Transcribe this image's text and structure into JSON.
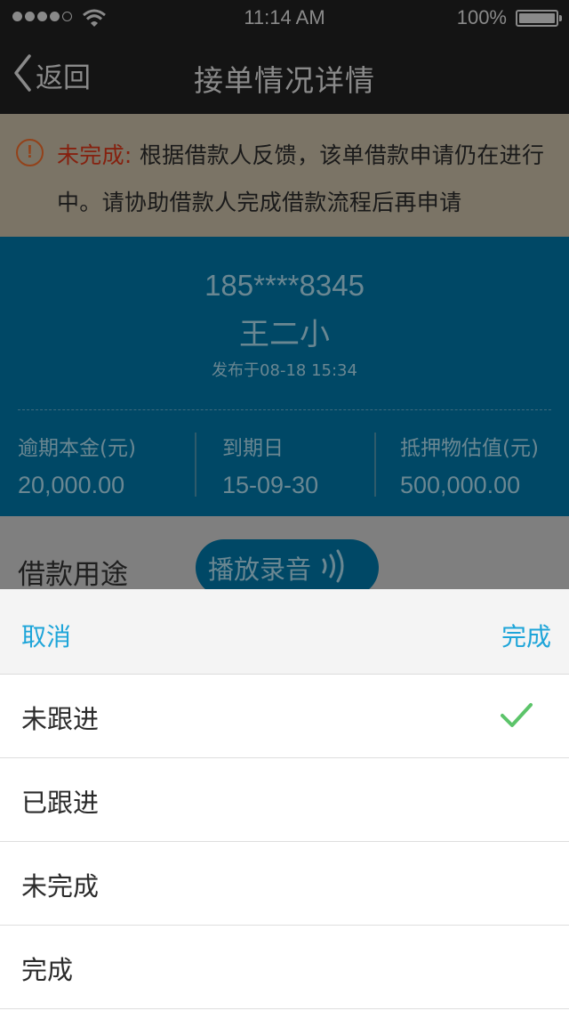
{
  "status_bar": {
    "time": "11:14 AM",
    "battery_percent": "100%",
    "signal_strength": 4,
    "signal_max": 5,
    "icons": [
      "signal-dots-icon",
      "wifi-icon",
      "battery-icon"
    ]
  },
  "nav": {
    "back_label": "返回",
    "title": "接单情况详情",
    "icons": [
      "back-chevron-icon"
    ]
  },
  "notice": {
    "label": "未完成:",
    "text": "根据借款人反馈，该单借款申请仍在进行中。请协助借款人完成借款流程后再申请",
    "icon": "warning-icon"
  },
  "card": {
    "phone": "185****8345",
    "name": "王二小",
    "published": "发布于08-18  15:34",
    "fields": [
      {
        "label": "逾期本金(元)",
        "value": "20,000.00"
      },
      {
        "label": "到期日",
        "value": "15-09-30"
      },
      {
        "label": "抵押物估值(元)",
        "value": "500,000.00"
      }
    ]
  },
  "purpose": {
    "label": "借款用途",
    "play_label": "播放录音",
    "play_icon": "sound-wave-icon"
  },
  "picker": {
    "cancel_label": "取消",
    "done_label": "完成",
    "options": [
      {
        "label": "未跟进",
        "selected": true
      },
      {
        "label": "已跟进",
        "selected": false
      },
      {
        "label": "未完成",
        "selected": false
      },
      {
        "label": "完成",
        "selected": false
      }
    ],
    "check_icon": "check-icon",
    "check_color": "#5cc46a"
  },
  "colors": {
    "accent": "#1ea5d9",
    "card_blue": "#004866",
    "warning_red": "#85210f"
  }
}
